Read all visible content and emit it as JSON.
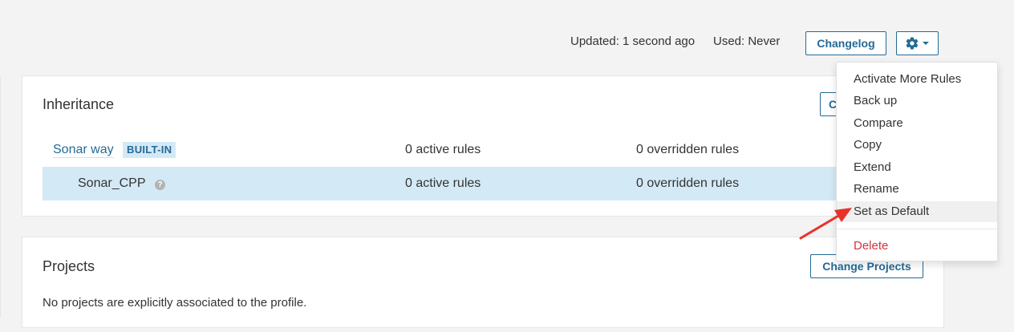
{
  "header": {
    "updated": "Updated: 1 second ago",
    "used": "Used: Never",
    "changelog_label": "Changelog",
    "actions_icon": "gear-icon"
  },
  "inheritance": {
    "title": "Inheritance",
    "change_parent_label_partial": "C",
    "rows": [
      {
        "name": "Sonar way",
        "badge": "BUILT-IN",
        "active": "0 active rules",
        "overridden": "0 overridden rules"
      },
      {
        "name": "Sonar_CPP",
        "help": "?",
        "active": "0 active rules",
        "overridden": "0 overridden rules"
      }
    ]
  },
  "projects": {
    "title": "Projects",
    "change_label": "Change Projects",
    "message": "No projects are explicitly associated to the profile."
  },
  "menu": {
    "items": [
      {
        "label": "Activate More Rules"
      },
      {
        "label": "Back up"
      },
      {
        "label": "Compare"
      },
      {
        "label": "Copy"
      },
      {
        "label": "Extend"
      },
      {
        "label": "Rename"
      },
      {
        "label": "Set as Default"
      }
    ],
    "delete_label": "Delete"
  },
  "colors": {
    "accent": "#236a97",
    "selected_row": "#d4e9f6",
    "danger": "#d4333f",
    "annotation_arrow": "#e8312a"
  }
}
